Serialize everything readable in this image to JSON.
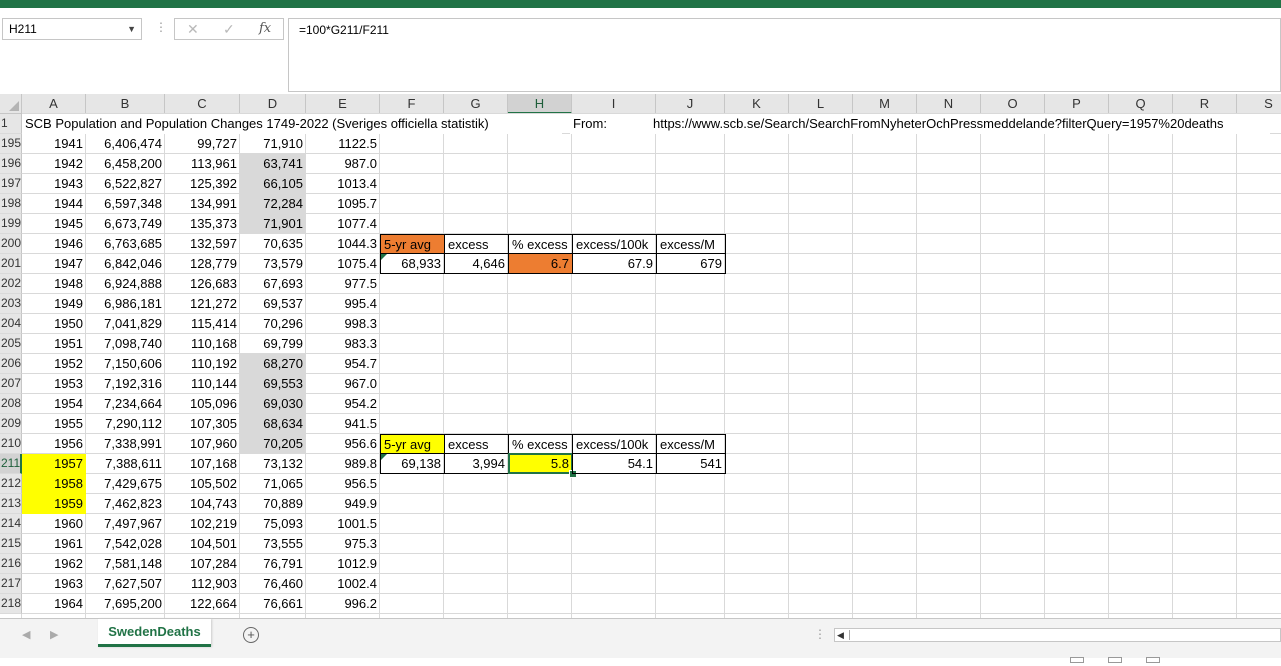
{
  "app": {
    "accent": "#217346"
  },
  "formula_bar": {
    "name_box": "H211",
    "cancel_icon": "✕",
    "confirm_icon": "✓",
    "fx_label": "fx",
    "formula": "=100*G211/F211"
  },
  "columns": [
    "A",
    "B",
    "C",
    "D",
    "E",
    "F",
    "G",
    "H",
    "I",
    "J",
    "K",
    "L",
    "M",
    "N",
    "O",
    "P",
    "Q",
    "R",
    "S"
  ],
  "selected_column": "H",
  "selected_row": "211",
  "row1": {
    "number": "1",
    "title": "SCB Population and Population Changes 1749-2022 (Sveriges officiella statistik)",
    "from_label": "From:",
    "url": "https://www.scb.se/Search/SearchFromNyheterOchPressmeddelande?filterQuery=1957%20deaths"
  },
  "rows": [
    {
      "num": "195",
      "year": "1941",
      "pop": "6,406,474",
      "births": "99,727",
      "deaths": "71,910",
      "rate": "1122.5"
    },
    {
      "num": "196",
      "year": "1942",
      "pop": "6,458,200",
      "births": "113,961",
      "deaths": "63,741",
      "rate": "987.0"
    },
    {
      "num": "197",
      "year": "1943",
      "pop": "6,522,827",
      "births": "125,392",
      "deaths": "66,105",
      "rate": "1013.4"
    },
    {
      "num": "198",
      "year": "1944",
      "pop": "6,597,348",
      "births": "134,991",
      "deaths": "72,284",
      "rate": "1095.7"
    },
    {
      "num": "199",
      "year": "1945",
      "pop": "6,673,749",
      "births": "135,373",
      "deaths": "71,901",
      "rate": "1077.4"
    },
    {
      "num": "200",
      "year": "1946",
      "pop": "6,763,685",
      "births": "132,597",
      "deaths": "70,635",
      "rate": "1044.3"
    },
    {
      "num": "201",
      "year": "1947",
      "pop": "6,842,046",
      "births": "128,779",
      "deaths": "73,579",
      "rate": "1075.4"
    },
    {
      "num": "202",
      "year": "1948",
      "pop": "6,924,888",
      "births": "126,683",
      "deaths": "67,693",
      "rate": "977.5"
    },
    {
      "num": "203",
      "year": "1949",
      "pop": "6,986,181",
      "births": "121,272",
      "deaths": "69,537",
      "rate": "995.4"
    },
    {
      "num": "204",
      "year": "1950",
      "pop": "7,041,829",
      "births": "115,414",
      "deaths": "70,296",
      "rate": "998.3"
    },
    {
      "num": "205",
      "year": "1951",
      "pop": "7,098,740",
      "births": "110,168",
      "deaths": "69,799",
      "rate": "983.3"
    },
    {
      "num": "206",
      "year": "1952",
      "pop": "7,150,606",
      "births": "110,192",
      "deaths": "68,270",
      "rate": "954.7"
    },
    {
      "num": "207",
      "year": "1953",
      "pop": "7,192,316",
      "births": "110,144",
      "deaths": "69,553",
      "rate": "967.0"
    },
    {
      "num": "208",
      "year": "1954",
      "pop": "7,234,664",
      "births": "105,096",
      "deaths": "69,030",
      "rate": "954.2"
    },
    {
      "num": "209",
      "year": "1955",
      "pop": "7,290,112",
      "births": "107,305",
      "deaths": "68,634",
      "rate": "941.5"
    },
    {
      "num": "210",
      "year": "1956",
      "pop": "7,338,991",
      "births": "107,960",
      "deaths": "70,205",
      "rate": "956.6"
    },
    {
      "num": "211",
      "year": "1957",
      "pop": "7,388,611",
      "births": "107,168",
      "deaths": "73,132",
      "rate": "989.8"
    },
    {
      "num": "212",
      "year": "1958",
      "pop": "7,429,675",
      "births": "105,502",
      "deaths": "71,065",
      "rate": "956.5"
    },
    {
      "num": "213",
      "year": "1959",
      "pop": "7,462,823",
      "births": "104,743",
      "deaths": "70,889",
      "rate": "949.9"
    },
    {
      "num": "214",
      "year": "1960",
      "pop": "7,497,967",
      "births": "102,219",
      "deaths": "75,093",
      "rate": "1001.5"
    },
    {
      "num": "215",
      "year": "1961",
      "pop": "7,542,028",
      "births": "104,501",
      "deaths": "73,555",
      "rate": "975.3"
    },
    {
      "num": "216",
      "year": "1962",
      "pop": "7,581,148",
      "births": "107,284",
      "deaths": "76,791",
      "rate": "1012.9"
    },
    {
      "num": "217",
      "year": "1963",
      "pop": "7,627,507",
      "births": "112,903",
      "deaths": "76,460",
      "rate": "1002.4"
    },
    {
      "num": "218",
      "year": "1964",
      "pop": "7,695,200",
      "births": "122,664",
      "deaths": "76,661",
      "rate": "996.2"
    }
  ],
  "gray_deaths_rows": [
    "1942",
    "1943",
    "1944",
    "1945",
    "1952",
    "1953",
    "1954",
    "1955",
    "1956"
  ],
  "yellow_year_rows": [
    "1957",
    "1958",
    "1959"
  ],
  "summary_1947": {
    "headers": [
      "5-yr avg",
      "excess",
      "% excess",
      "excess/100k",
      "excess/M"
    ],
    "values": [
      "68,933",
      "4,646",
      "6.7",
      "67.9",
      "679"
    ],
    "highlight": "#ed7d31"
  },
  "summary_1957": {
    "headers": [
      "5-yr avg",
      "excess",
      "% excess",
      "excess/100k",
      "excess/M"
    ],
    "values": [
      "69,138",
      "3,994",
      "5.8",
      "54.1",
      "541"
    ],
    "highlight": "#ffff00"
  },
  "sheet_tabs": {
    "active": "SwedenDeaths",
    "add_icon": "+"
  }
}
